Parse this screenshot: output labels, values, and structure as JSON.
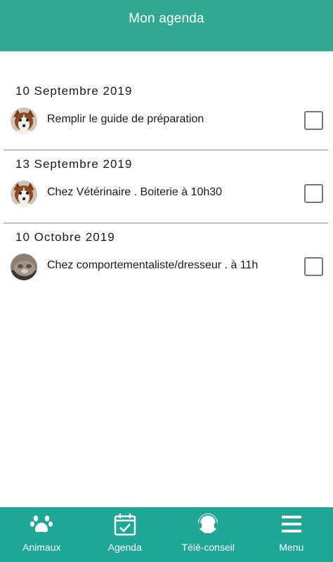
{
  "header": {
    "title": "Mon agenda"
  },
  "sections": [
    {
      "date": "10 Septembre 2019",
      "task": "Remplir le guide de préparation",
      "avatar": "dog-avatar"
    },
    {
      "date": "13 Septembre 2019",
      "task": "Chez Vétérinaire . Boiterie à 10h30",
      "avatar": "dog-avatar"
    },
    {
      "date": "10 Octobre 2019",
      "task": "Chez comportementaliste/dresseur .  à 11h",
      "avatar": "cat-avatar"
    }
  ],
  "nav": {
    "animaux": {
      "label": "Animaux",
      "icon": "paw-icon"
    },
    "agenda": {
      "label": "Agenda",
      "icon": "calendar-check-icon"
    },
    "teleconseil": {
      "label": "Télé-conseil",
      "icon": "headset-icon"
    },
    "menu": {
      "label": "Menu",
      "icon": "hamburger-icon"
    }
  },
  "colors": {
    "header": "#2fa98f",
    "nav": "#1ea797"
  }
}
